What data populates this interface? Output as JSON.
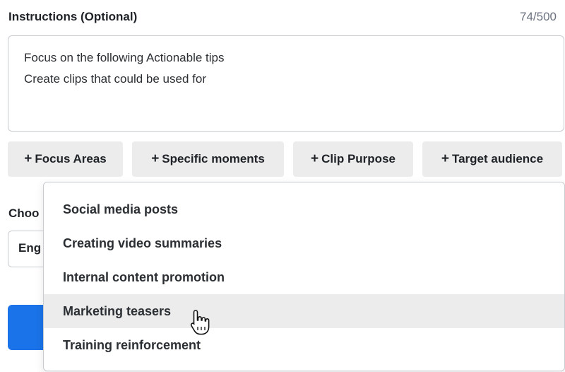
{
  "instructions": {
    "label": "Instructions (Optional)",
    "counter": "74/500",
    "lines": [
      "Focus on the following Actionable tips",
      "Create clips that could be used for"
    ]
  },
  "chips": [
    {
      "label": "Focus Areas"
    },
    {
      "label": "Specific moments"
    },
    {
      "label": "Clip Purpose"
    },
    {
      "label": "Target audience"
    }
  ],
  "background": {
    "choose_label_fragment": "Choo",
    "language_fragment": "Eng"
  },
  "dropdown": {
    "items": [
      {
        "label": "Social media posts"
      },
      {
        "label": "Creating video summaries"
      },
      {
        "label": "Internal content promotion"
      },
      {
        "label": "Marketing teasers"
      },
      {
        "label": "Training reinforcement"
      }
    ],
    "hovered_item": "Marketing teasers"
  },
  "colors": {
    "primary": "#1a73e8",
    "chip_bg": "#ececec",
    "hover_bg": "#ececec"
  }
}
